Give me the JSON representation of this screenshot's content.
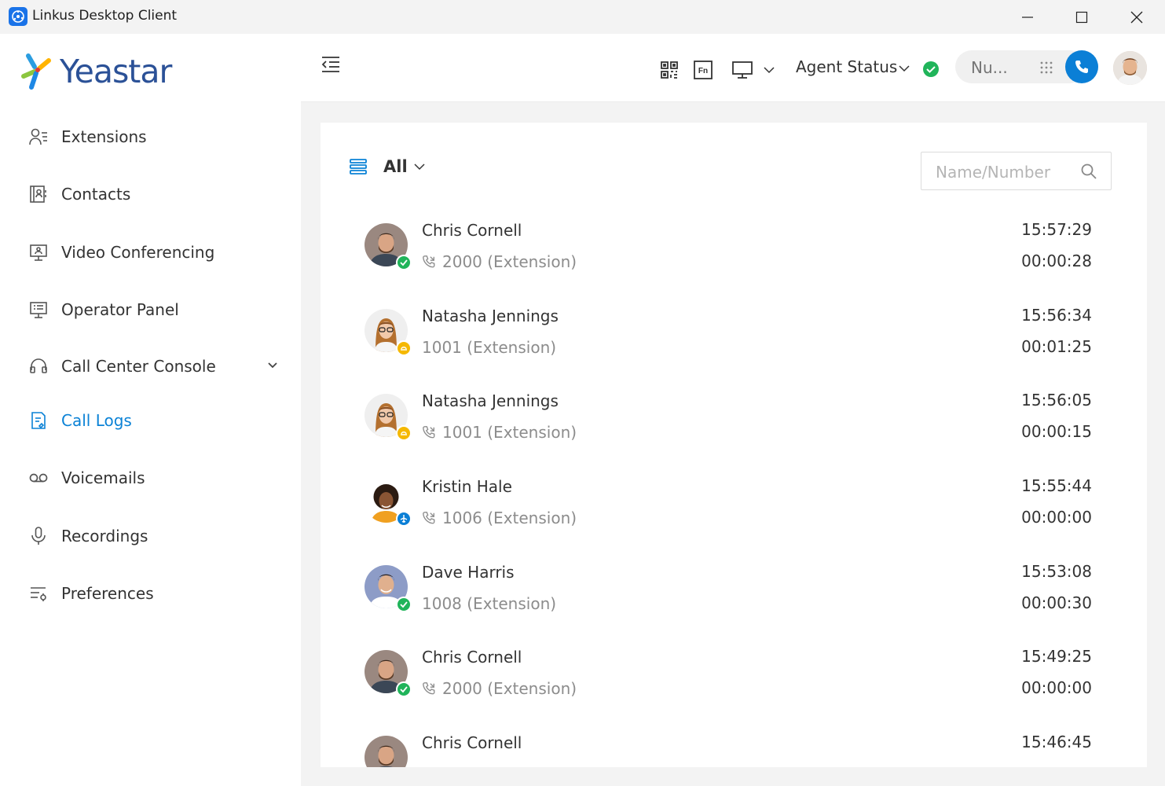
{
  "window": {
    "title": "Linkus Desktop Client"
  },
  "brand": {
    "logo_text": "Yeastar",
    "accent": "#0b82d6"
  },
  "sidebar": {
    "items": [
      {
        "label": "Extensions",
        "icon": "extensions-icon"
      },
      {
        "label": "Contacts",
        "icon": "contacts-icon"
      },
      {
        "label": "Video Conferencing",
        "icon": "video-conferencing-icon"
      },
      {
        "label": "Operator Panel",
        "icon": "operator-panel-icon"
      },
      {
        "label": "Call Center Console",
        "icon": "headset-icon"
      },
      {
        "label": "Call Logs",
        "icon": "call-logs-icon",
        "active": true
      },
      {
        "label": "Voicemails",
        "icon": "voicemail-icon"
      },
      {
        "label": "Recordings",
        "icon": "microphone-icon"
      },
      {
        "label": "Preferences",
        "icon": "preferences-icon"
      }
    ]
  },
  "topbar": {
    "agent_status_label": "Agent Status",
    "dial_placeholder": "Nu..."
  },
  "filter": {
    "label": "All"
  },
  "search": {
    "placeholder": "Name/Number"
  },
  "call_logs": [
    {
      "name": "Chris Cornell",
      "number": "2000 (Extension)",
      "time": "15:57:29",
      "duration": "00:00:28",
      "status": "available",
      "call_icon": true
    },
    {
      "name": "Natasha Jennings",
      "number": "1001 (Extension)",
      "time": "15:56:34",
      "duration": "00:01:25",
      "status": "lunch",
      "call_icon": false
    },
    {
      "name": "Natasha Jennings",
      "number": "1001 (Extension)",
      "time": "15:56:05",
      "duration": "00:00:15",
      "status": "lunch",
      "call_icon": true
    },
    {
      "name": "Kristin Hale",
      "number": "1006 (Extension)",
      "time": "15:55:44",
      "duration": "00:00:00",
      "status": "travel",
      "call_icon": true
    },
    {
      "name": "Dave Harris",
      "number": "1008 (Extension)",
      "time": "15:53:08",
      "duration": "00:00:30",
      "status": "available",
      "call_icon": false
    },
    {
      "name": "Chris Cornell",
      "number": "2000 (Extension)",
      "time": "15:49:25",
      "duration": "00:00:00",
      "status": "available",
      "call_icon": true
    },
    {
      "name": "Chris Cornell",
      "number": "",
      "time": "15:46:45",
      "duration": "",
      "status": "available",
      "call_icon": false
    }
  ]
}
